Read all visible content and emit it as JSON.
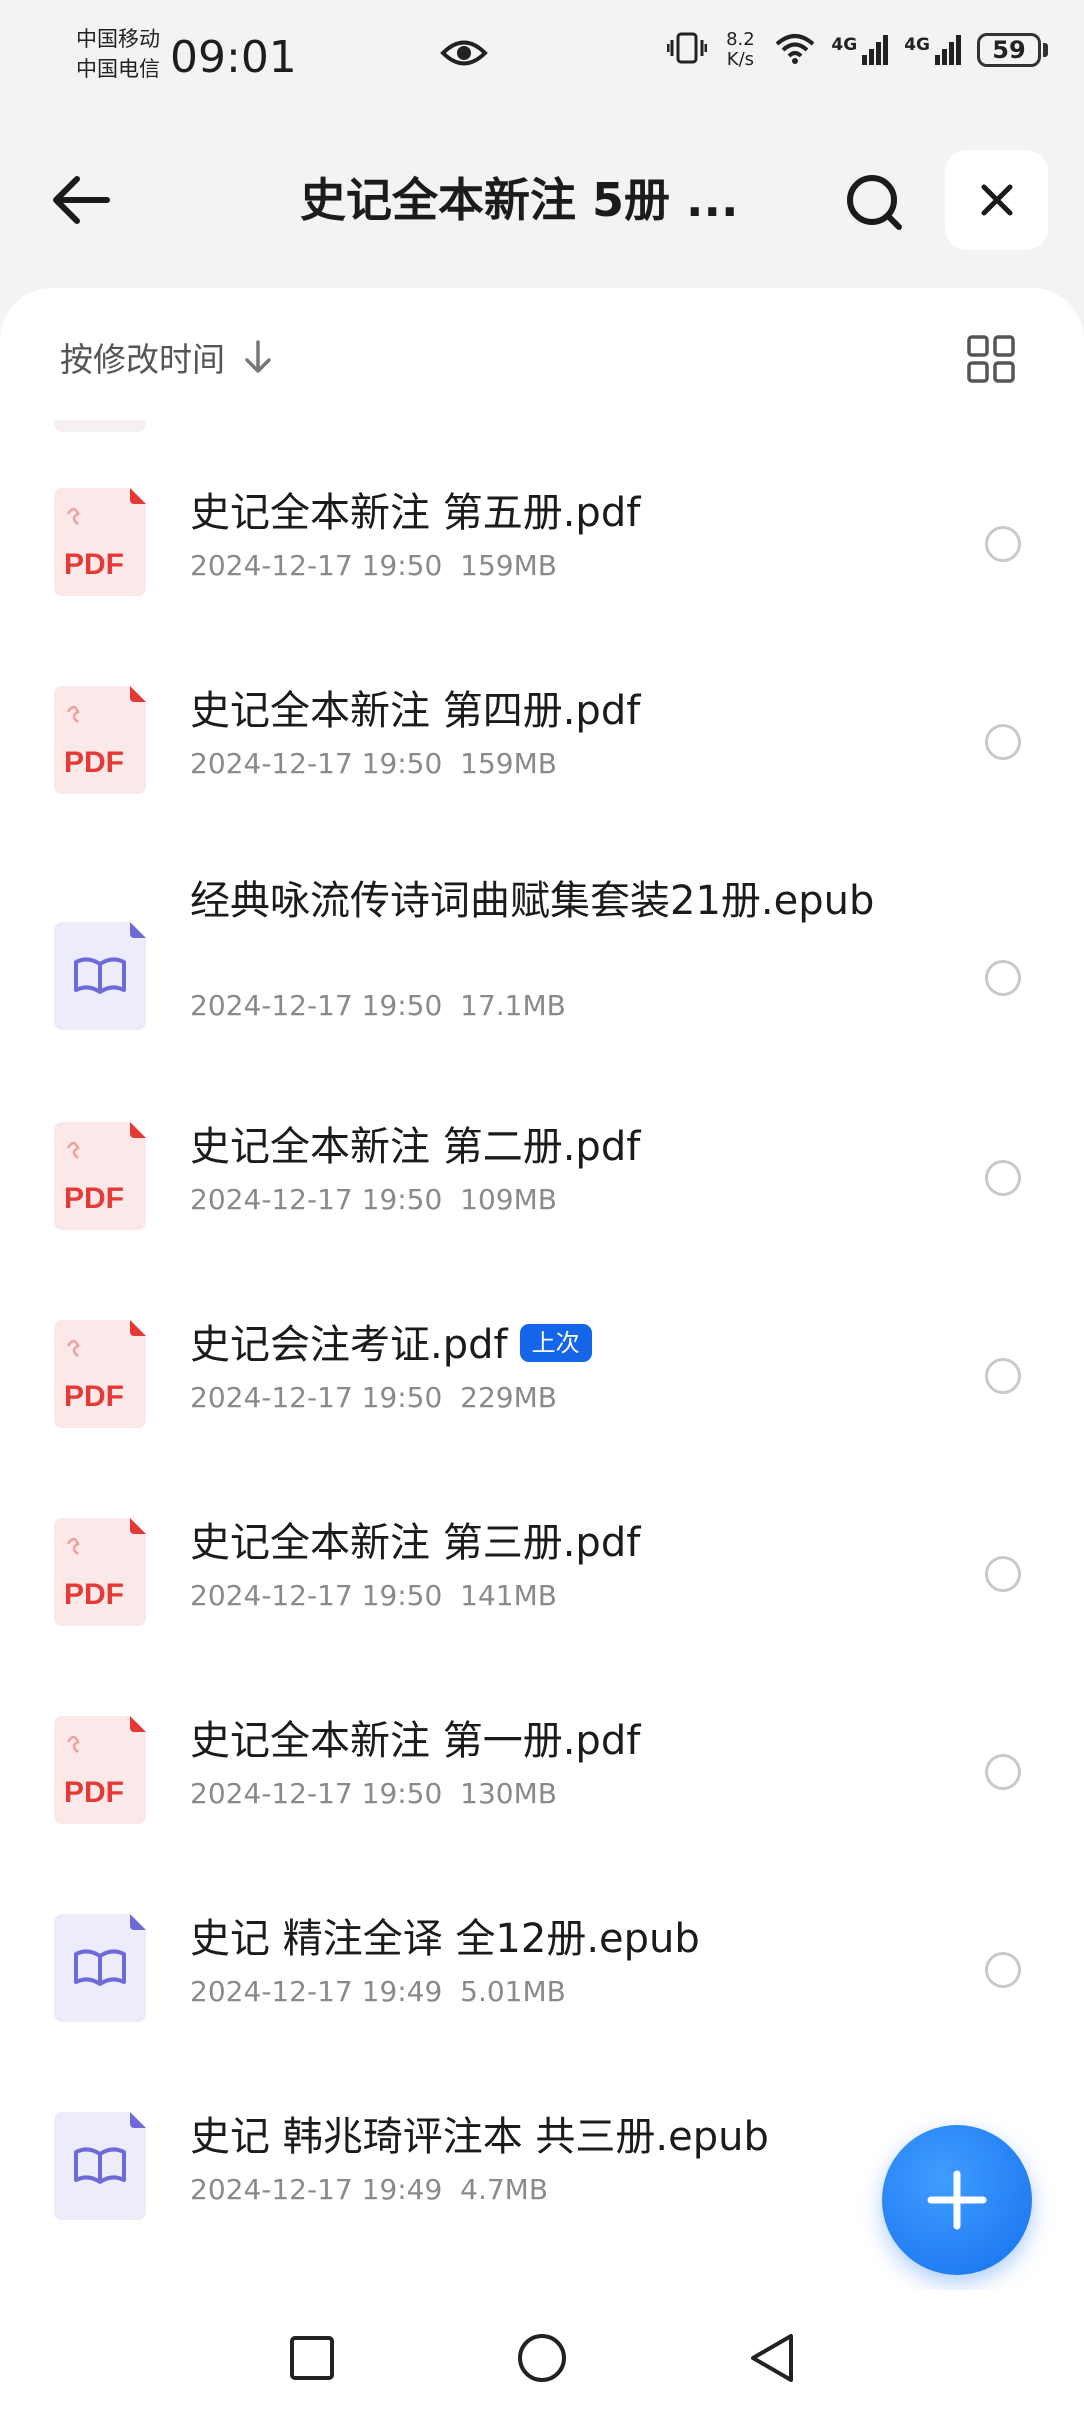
{
  "status_bar": {
    "carrier_1": "中国移动",
    "carrier_2": "中国电信",
    "time": "09:01",
    "speed_value": "8.2",
    "speed_unit": "K/s",
    "network_1": "4G",
    "network_2": "4G",
    "battery": "59"
  },
  "header": {
    "title": "史记全本新注 5册 ...",
    "icons": [
      "back-arrow-icon",
      "search-icon",
      "close-icon"
    ]
  },
  "sortbar": {
    "sort_label": "按修改时间",
    "icons": [
      "arrow-down-icon",
      "grid-view-icon"
    ]
  },
  "files": [
    {
      "name": "史记全本新注 第五册.pdf",
      "date": "2024-12-17 19:50",
      "size": "159MB",
      "type": "pdf",
      "badge": ""
    },
    {
      "name": "史记全本新注 第四册.pdf",
      "date": "2024-12-17 19:50",
      "size": "159MB",
      "type": "pdf",
      "badge": ""
    },
    {
      "name": "经典咏流传诗词曲赋集套装21册.epub",
      "date": "2024-12-17 19:50",
      "size": "17.1MB",
      "type": "epub",
      "badge": ""
    },
    {
      "name": "史记全本新注 第二册.pdf",
      "date": "2024-12-17 19:50",
      "size": "109MB",
      "type": "pdf",
      "badge": ""
    },
    {
      "name": "史记会注考证.pdf",
      "date": "2024-12-17 19:50",
      "size": "229MB",
      "type": "pdf",
      "badge": "上次"
    },
    {
      "name": "史记全本新注 第三册.pdf",
      "date": "2024-12-17 19:50",
      "size": "141MB",
      "type": "pdf",
      "badge": ""
    },
    {
      "name": "史记全本新注 第一册.pdf",
      "date": "2024-12-17 19:50",
      "size": "130MB",
      "type": "pdf",
      "badge": ""
    },
    {
      "name": "史记 精注全译 全12册.epub",
      "date": "2024-12-17 19:49",
      "size": "5.01MB",
      "type": "epub",
      "badge": ""
    },
    {
      "name": "史记 韩兆琦评注本 共三册.epub",
      "date": "2024-12-17 19:49",
      "size": "4.7MB",
      "type": "epub",
      "badge": ""
    }
  ],
  "pdf_icon_label": "PDF",
  "colors": {
    "accent": "#1771ee",
    "pdf_red": "#e53935",
    "epub_purple": "#6f6ad8",
    "badge_blue": "#1565e8"
  }
}
